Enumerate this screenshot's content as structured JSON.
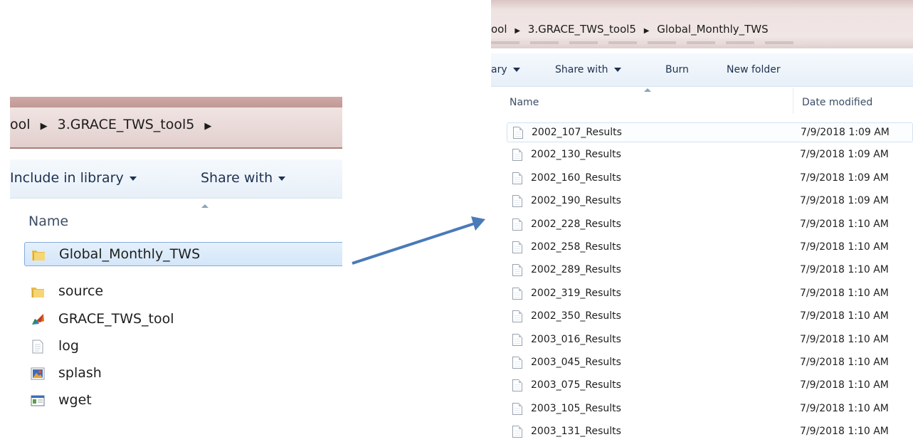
{
  "left_window": {
    "breadcrumb": [
      "ool",
      "3.GRACE_TWS_tool5"
    ],
    "toolbar": {
      "include_label": "Include in library",
      "share_label": "Share with"
    },
    "columns": {
      "name": "Name"
    },
    "items": [
      {
        "name": "Global_Monthly_TWS",
        "icon": "folder-icon"
      },
      {
        "name": "source",
        "icon": "folder-icon"
      },
      {
        "name": "GRACE_TWS_tool",
        "icon": "matlab-app-icon"
      },
      {
        "name": "log",
        "icon": "text-file-icon"
      },
      {
        "name": "splash",
        "icon": "image-file-icon"
      },
      {
        "name": "wget",
        "icon": "executable-icon"
      }
    ]
  },
  "right_window": {
    "breadcrumb": [
      "ool",
      "3.GRACE_TWS_tool5",
      "Global_Monthly_TWS"
    ],
    "toolbar": {
      "library_label": "ary",
      "share_label": "Share with",
      "burn_label": "Burn",
      "new_folder_label": "New folder"
    },
    "columns": {
      "name": "Name",
      "date": "Date modified"
    },
    "files": [
      {
        "name": "2002_107_Results",
        "date": "7/9/2018 1:09 AM"
      },
      {
        "name": "2002_130_Results",
        "date": "7/9/2018 1:09 AM"
      },
      {
        "name": "2002_160_Results",
        "date": "7/9/2018 1:09 AM"
      },
      {
        "name": "2002_190_Results",
        "date": "7/9/2018 1:09 AM"
      },
      {
        "name": "2002_228_Results",
        "date": "7/9/2018 1:10 AM"
      },
      {
        "name": "2002_258_Results",
        "date": "7/9/2018 1:10 AM"
      },
      {
        "name": "2002_289_Results",
        "date": "7/9/2018 1:10 AM"
      },
      {
        "name": "2002_319_Results",
        "date": "7/9/2018 1:10 AM"
      },
      {
        "name": "2002_350_Results",
        "date": "7/9/2018 1:10 AM"
      },
      {
        "name": "2003_016_Results",
        "date": "7/9/2018 1:10 AM"
      },
      {
        "name": "2003_045_Results",
        "date": "7/9/2018 1:10 AM"
      },
      {
        "name": "2003_075_Results",
        "date": "7/9/2018 1:10 AM"
      },
      {
        "name": "2003_105_Results",
        "date": "7/9/2018 1:10 AM"
      },
      {
        "name": "2003_131_Results",
        "date": "7/9/2018 1:10 AM"
      }
    ]
  },
  "arrow": {
    "color": "#4a7ab8",
    "icon": "arrow-right-icon"
  }
}
